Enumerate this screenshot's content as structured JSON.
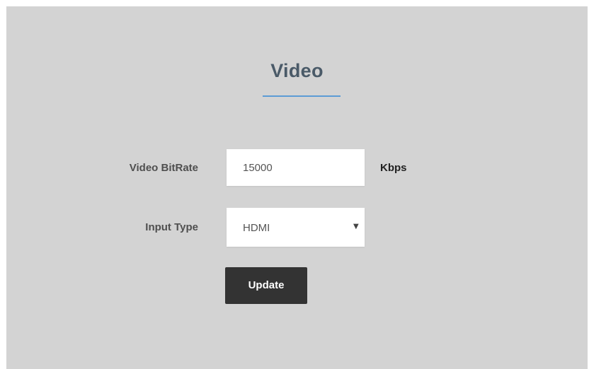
{
  "section": {
    "title": "Video"
  },
  "form": {
    "bitrate": {
      "label": "Video BitRate",
      "value": "15000",
      "unit": "Kbps"
    },
    "input_type": {
      "label": "Input Type",
      "selected": "HDMI",
      "caret_glyph": "▼"
    },
    "update_label": "Update"
  },
  "colors": {
    "panel_background": "#d3d3d3",
    "title": "#4a5a68",
    "title_underline": "#5b9bd5",
    "button_background": "#333333",
    "button_text": "#ffffff"
  },
  "icons": {
    "select_caret": "chevron-down-icon"
  }
}
